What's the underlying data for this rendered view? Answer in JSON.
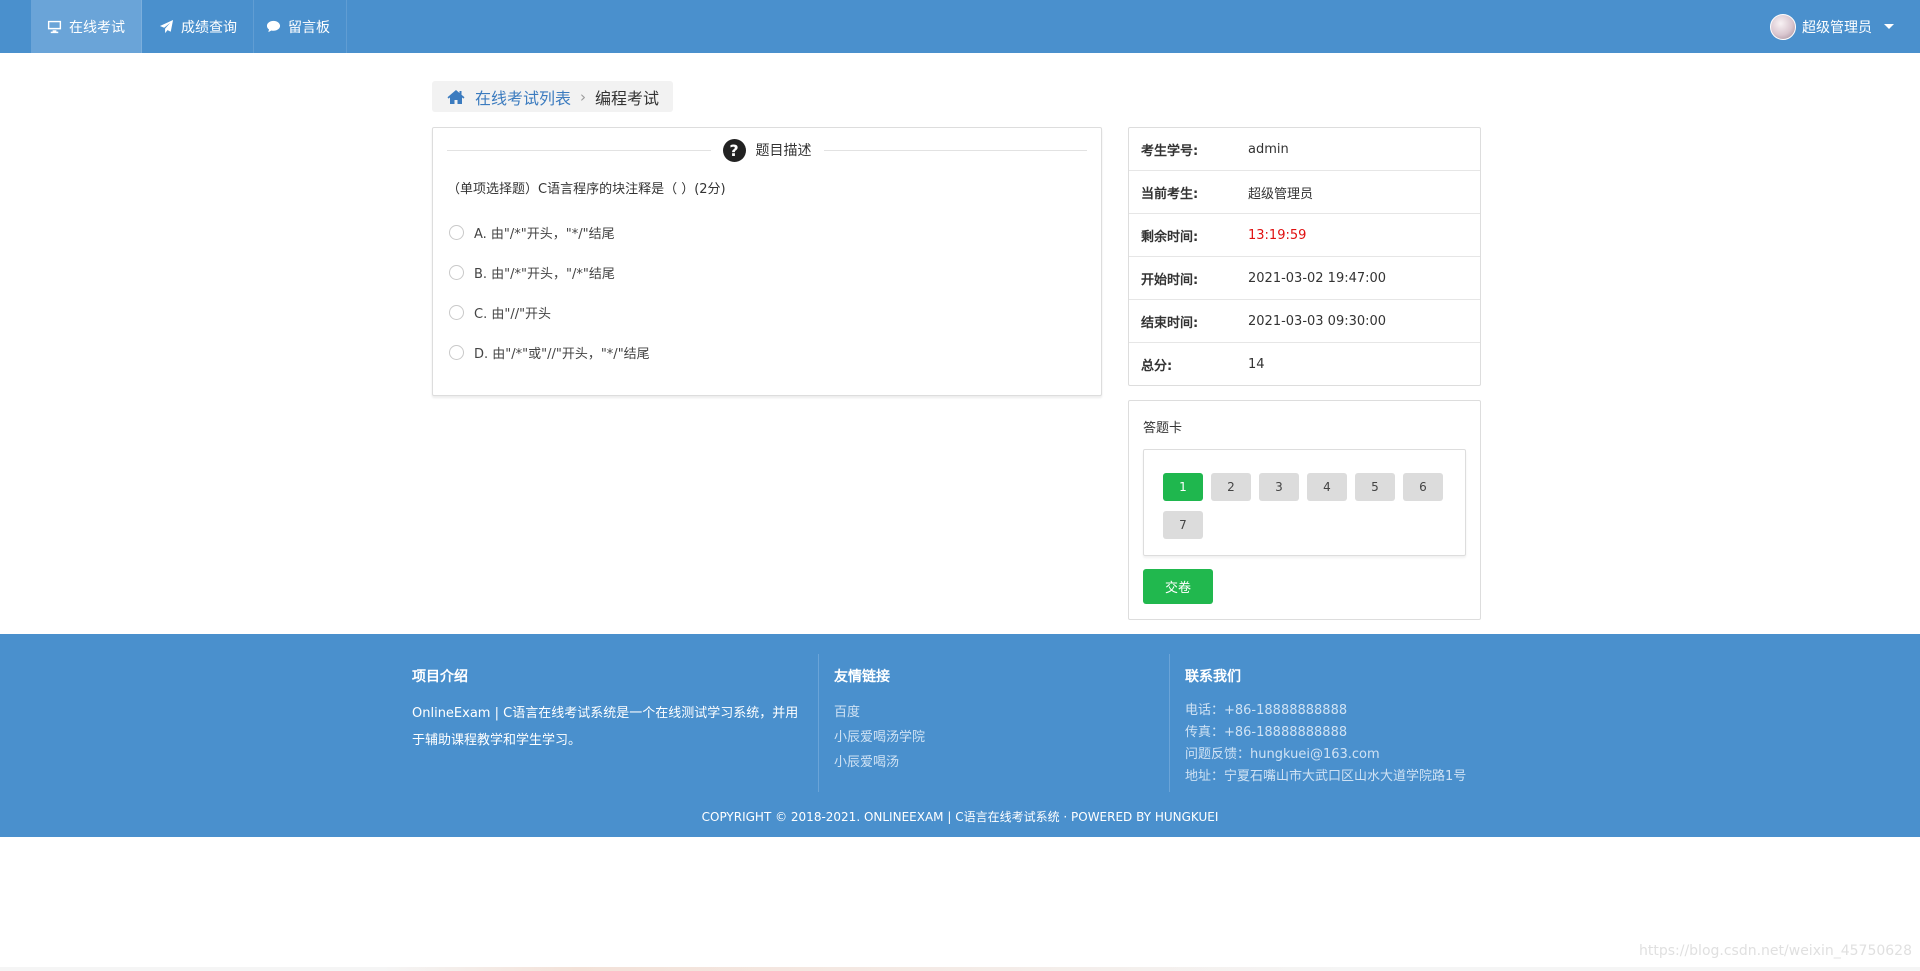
{
  "nav": {
    "items": [
      {
        "label": "在线考试",
        "icon": "monitor-icon"
      },
      {
        "label": "成绩查询",
        "icon": "paper-plane-icon"
      },
      {
        "label": "留言板",
        "icon": "comments-icon"
      }
    ],
    "user": {
      "name": "超级管理员"
    },
    "colors": {
      "bar": "#4a90cd",
      "active": "#6aa4d8"
    }
  },
  "breadcrumb": {
    "link": "在线考试列表",
    "current": "编程考试",
    "separator": "›"
  },
  "question": {
    "header": "题目描述",
    "text": "（单项选择题）C语言程序的块注释是（ ）(2分)",
    "options": [
      "A. 由\"/*\"开头，\"*/\"结尾",
      "B. 由\"/*\"开头，\"/*\"结尾",
      "C. 由\"//\"开头",
      "D. 由\"/*\"或\"//\"开头，\"*/\"结尾"
    ]
  },
  "exam_info": {
    "rows": [
      {
        "label": "考生学号:",
        "value": "admin"
      },
      {
        "label": "当前考生:",
        "value": "超级管理员"
      },
      {
        "label": "剩余时间:",
        "value": "13:19:59"
      },
      {
        "label": "开始时间:",
        "value": "2021-03-02 19:47:00"
      },
      {
        "label": "结束时间:",
        "value": "2021-03-03 09:30:00"
      },
      {
        "label": "总分:",
        "value": "14"
      }
    ],
    "highlight_color": "#e01010"
  },
  "answer_card": {
    "title": "答题卡",
    "numbers": [
      "1",
      "2",
      "3",
      "4",
      "5",
      "6",
      "7"
    ],
    "current": "1",
    "submit_label": "交卷",
    "active_color": "#1fb74e"
  },
  "footer": {
    "intro": {
      "heading": "项目介绍",
      "text": "OnlineExam | C语言在线考试系统是一个在线测试学习系统，并用于辅助课程教学和学生学习。"
    },
    "links": {
      "heading": "友情链接",
      "items": [
        "百度",
        "小辰爱喝汤学院",
        "小辰爱喝汤"
      ]
    },
    "contact": {
      "heading": "联系我们",
      "lines": [
        "电话：+86-18888888888",
        "传真：+86-18888888888",
        "问题反馈：hungkuei@163.com",
        "地址：宁夏石嘴山市大武口区山水大道学院路1号"
      ]
    },
    "copyright": "COPYRIGHT © 2018-2021. ONLINEEXAM | C语言在线考试系统 · POWERED BY HUNGKUEI"
  },
  "watermark": "https://blog.csdn.net/weixin_45750628"
}
